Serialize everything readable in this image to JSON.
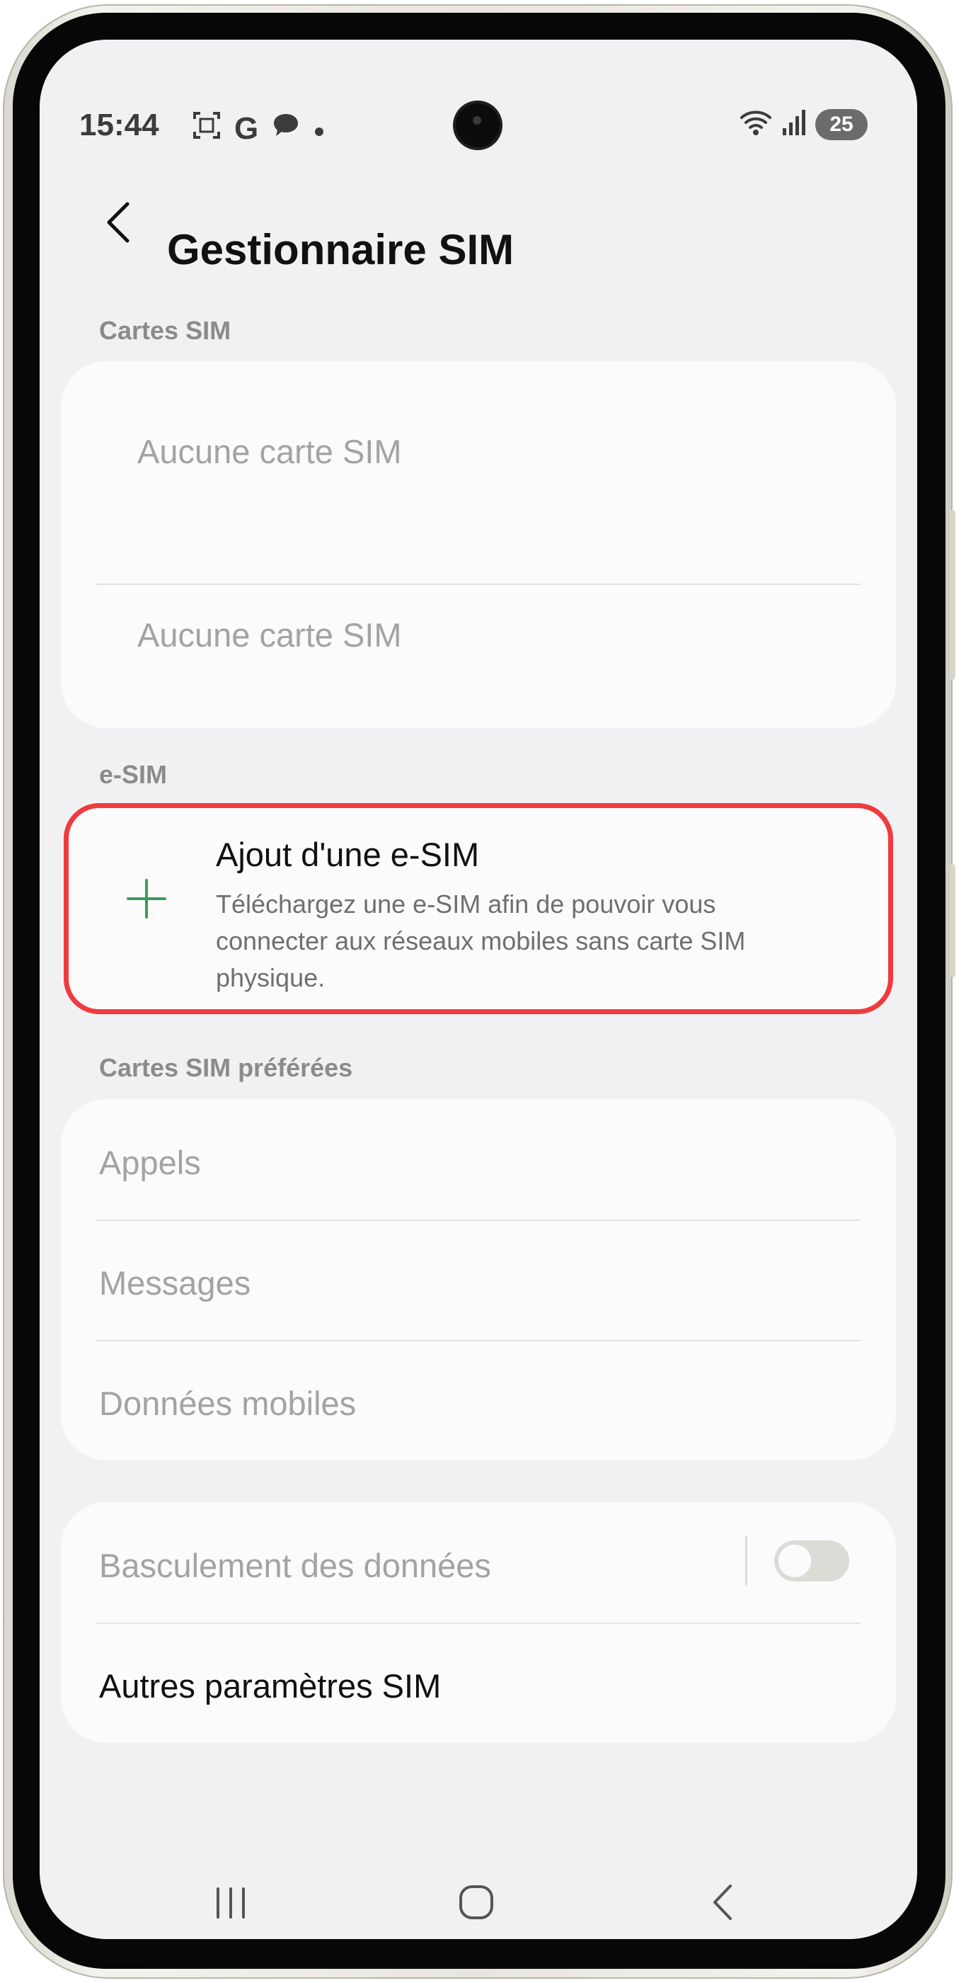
{
  "status_bar": {
    "time": "15:44",
    "notification_icons": [
      "screenshot-icon",
      "google-icon",
      "chat-icon",
      "dot-icon"
    ],
    "battery": "25"
  },
  "header": {
    "title": "Gestionnaire SIM"
  },
  "sim_cards": {
    "label": "Cartes SIM",
    "items": [
      "Aucune carte SIM",
      "Aucune carte SIM"
    ]
  },
  "esim": {
    "label": "e-SIM",
    "add_title": "Ajout d'une e-SIM",
    "add_desc": "Téléchargez une e-SIM afin de pouvoir vous connecter aux réseaux mobiles sans carte SIM physique.",
    "accent_color": "#3a9b5c",
    "highlight_color": "#ef3b3f"
  },
  "preferred": {
    "label": "Cartes SIM préférées",
    "items": [
      "Appels",
      "Messages",
      "Données mobiles"
    ]
  },
  "other": {
    "data_switch_label": "Basculement des données",
    "data_switch_on": false,
    "more_settings": "Autres paramètres SIM"
  }
}
